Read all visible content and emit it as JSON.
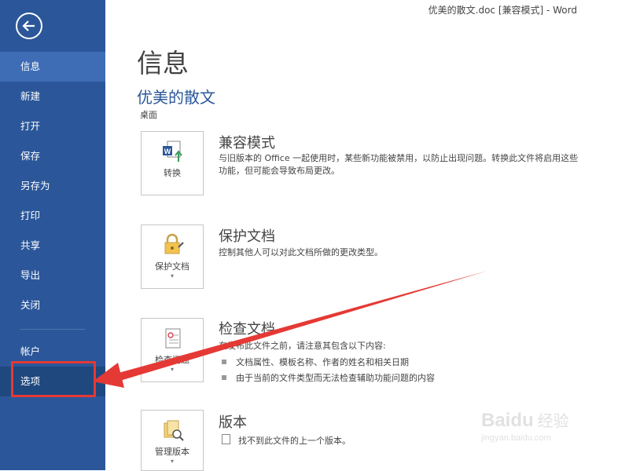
{
  "window": {
    "title": "优美的散文.doc [兼容模式] - Word"
  },
  "sidebar": {
    "items": [
      {
        "label": "信息"
      },
      {
        "label": "新建"
      },
      {
        "label": "打开"
      },
      {
        "label": "保存"
      },
      {
        "label": "另存为"
      },
      {
        "label": "打印"
      },
      {
        "label": "共享"
      },
      {
        "label": "导出"
      },
      {
        "label": "关闭"
      }
    ],
    "account": "帐户",
    "options": "选项"
  },
  "main": {
    "title": "信息",
    "doc_name": "优美的散文",
    "doc_path": "桌面",
    "sections": [
      {
        "button": "转换",
        "title": "兼容模式",
        "desc": "与旧版本的 Office 一起使用时，某些新功能被禁用，以防止出现问题。转换此文件将启用这些功能，但可能会导致布局更改。"
      },
      {
        "button": "保护文档",
        "title": "保护文档",
        "desc": "控制其他人可以对此文档所做的更改类型。"
      },
      {
        "button": "检查问题",
        "title": "检查文档",
        "desc": "在发布此文件之前，请注意其包含以下内容:",
        "bullets": [
          "文档属性、模板名称、作者的姓名和相关日期",
          "由于当前的文件类型而无法检查辅助功能问题的内容"
        ]
      },
      {
        "button": "管理版本",
        "title": "版本",
        "desc": "找不到此文件的上一个版本。"
      }
    ]
  },
  "watermark": {
    "logo": "Baidu",
    "name": "经验",
    "url": "jingyan.baidu.com"
  },
  "colors": {
    "sidebar": "#2b579a",
    "active": "#3e6db5",
    "highlight": "#e53935"
  }
}
